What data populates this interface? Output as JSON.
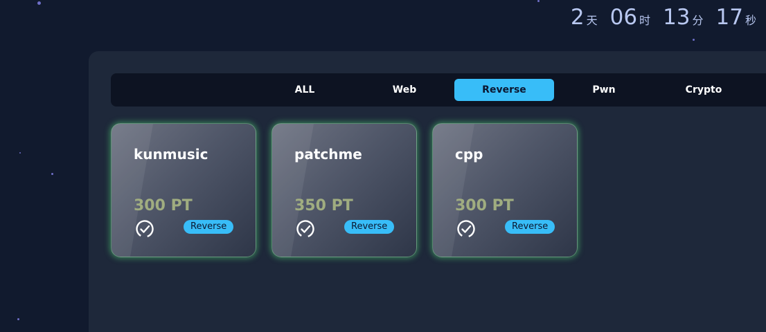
{
  "countdown": {
    "days": "2",
    "days_unit": "天",
    "hours": "06",
    "hours_unit": "时",
    "minutes": "13",
    "minutes_unit": "分",
    "seconds": "17",
    "seconds_unit": "秒"
  },
  "tabs": [
    {
      "label": "ALL",
      "active": false
    },
    {
      "label": "Web",
      "active": false
    },
    {
      "label": "Reverse",
      "active": true
    },
    {
      "label": "Pwn",
      "active": false
    },
    {
      "label": "Crypto",
      "active": false
    }
  ],
  "challenges": [
    {
      "name": "kunmusic",
      "points": "300 PT",
      "category": "Reverse",
      "status_icon": "check-circle-icon"
    },
    {
      "name": "patchme",
      "points": "350 PT",
      "category": "Reverse",
      "status_icon": "check-circle-icon"
    },
    {
      "name": "cpp",
      "points": "300 PT",
      "category": "Reverse",
      "status_icon": "check-circle-icon"
    }
  ],
  "colors": {
    "background": "#111a2e",
    "panel": "#1e283a",
    "accent": "#38bdf8",
    "card_glow": "#4abe6e",
    "points_text": "#a0ad80"
  }
}
